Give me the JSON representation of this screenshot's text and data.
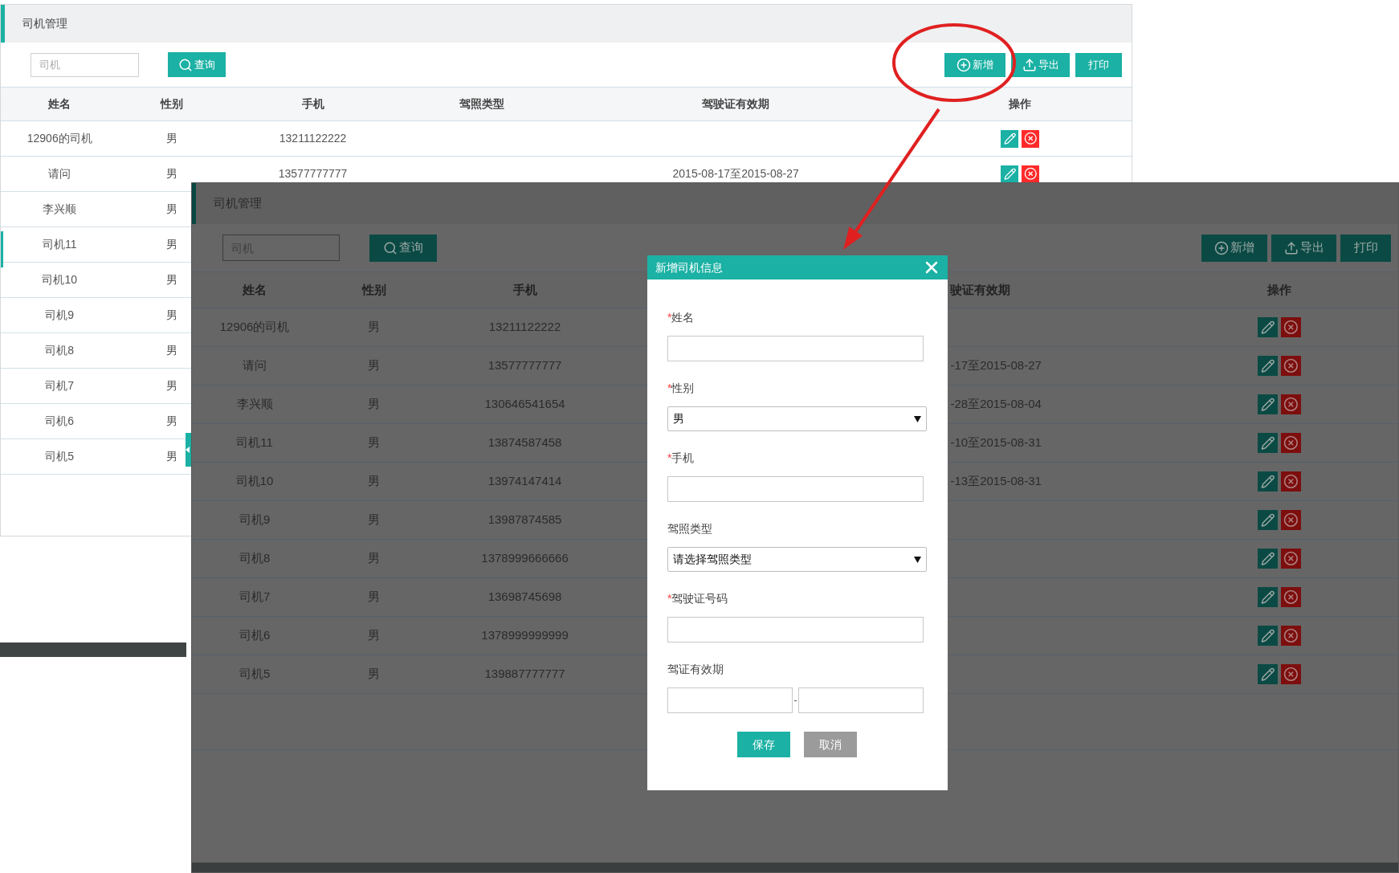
{
  "back_screen": {
    "dimmed": false,
    "title": "司机管理",
    "search": {
      "placeholder": "司机"
    },
    "query_button": "查询",
    "toolbar_buttons": [
      {
        "kind": "add",
        "label": "新增"
      },
      {
        "kind": "export",
        "label": "导出"
      },
      {
        "kind": "print",
        "label": "打印"
      }
    ],
    "columns": {
      "name": "姓名",
      "gender": "性别",
      "phone": "手机",
      "license_type": "驾照类型",
      "validity": "驾驶证有效期",
      "actions": "操作"
    },
    "rows": [
      {
        "name": "12906的司机",
        "gender": "男",
        "phone": "13211122222"
      },
      {
        "name": "请问",
        "gender": "男",
        "phone": "13577777777",
        "validity": "2015-08-17至2015-08-27"
      },
      {
        "name": "李兴顺",
        "gender": "男"
      },
      {
        "name": "司机11",
        "gender": "男"
      },
      {
        "name": "司机10",
        "gender": "男"
      },
      {
        "name": "司机9",
        "gender": "男"
      },
      {
        "name": "司机8",
        "gender": "男"
      },
      {
        "name": "司机7",
        "gender": "男"
      },
      {
        "name": "司机6",
        "gender": "男"
      },
      {
        "name": "司机5",
        "gender": "男"
      }
    ]
  },
  "front_screen": {
    "dimmed": true,
    "title": "司机管理",
    "search": {
      "placeholder": "司机"
    },
    "query_button": "查询",
    "toolbar_buttons": [
      {
        "kind": "add",
        "label": "新增"
      },
      {
        "kind": "export",
        "label": "导出"
      },
      {
        "kind": "print",
        "label": "打印"
      }
    ],
    "columns": {
      "name": "姓名",
      "gender": "性别",
      "phone": "手机",
      "validity": "驶证有效期",
      "actions": "操作"
    },
    "rows": [
      {
        "name": "12906的司机",
        "gender": "男",
        "phone": "13211122222"
      },
      {
        "name": "请问",
        "gender": "男",
        "phone": "13577777777",
        "validity": "-17至2015-08-27"
      },
      {
        "name": "李兴顺",
        "gender": "男",
        "phone": "130646541654",
        "validity": "-28至2015-08-04"
      },
      {
        "name": "司机11",
        "gender": "男",
        "phone": "13874587458",
        "validity": "-10至2015-08-31"
      },
      {
        "name": "司机10",
        "gender": "男",
        "phone": "13974147414",
        "validity": "-13至2015-08-31"
      },
      {
        "name": "司机9",
        "gender": "男",
        "phone": "13987874585"
      },
      {
        "name": "司机8",
        "gender": "男",
        "phone": "1378999666666"
      },
      {
        "name": "司机7",
        "gender": "男",
        "phone": "13698745698"
      },
      {
        "name": "司机6",
        "gender": "男",
        "phone": "1378999999999"
      },
      {
        "name": "司机5",
        "gender": "男",
        "phone": "139887777777"
      }
    ]
  },
  "dialog": {
    "title": "新增司机信息",
    "fields": [
      {
        "kind": "input",
        "label": "姓名",
        "required_mark": "*"
      },
      {
        "kind": "select",
        "label": "性别",
        "required_mark": "*",
        "value": "男"
      },
      {
        "kind": "input",
        "label": "手机",
        "required_mark": "*"
      },
      {
        "kind": "select",
        "label": "驾照类型",
        "value": "请选择驾照类型"
      },
      {
        "kind": "input",
        "label": "驾驶证号码",
        "required_mark": "*"
      },
      {
        "kind": "date_range",
        "label": "驾证有效期",
        "separator": "-"
      }
    ],
    "buttons": [
      {
        "kind": "primary",
        "label": "保存"
      },
      {
        "kind": "secondary",
        "label": "取消"
      }
    ]
  }
}
